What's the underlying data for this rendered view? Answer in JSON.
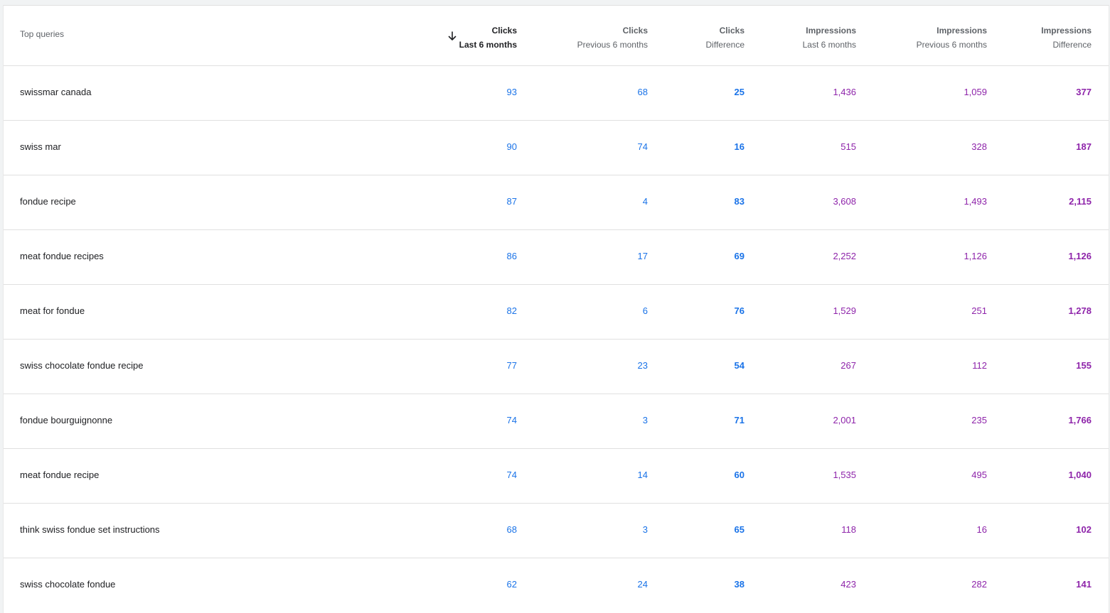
{
  "header": {
    "query_label": "Top queries",
    "columns": [
      {
        "line1": "Clicks",
        "line2": "Last 6 months",
        "sorted": true
      },
      {
        "line1": "Clicks",
        "line2": "Previous 6 months"
      },
      {
        "line1": "Clicks",
        "line2": "Difference"
      },
      {
        "line1": "Impressions",
        "line2": "Last 6 months"
      },
      {
        "line1": "Impressions",
        "line2": "Previous 6 months"
      },
      {
        "line1": "Impressions",
        "line2": "Difference"
      }
    ],
    "sort_icon": "arrow-down-icon"
  },
  "colors": {
    "clicks": "#1a73e8",
    "impressions": "#8e24aa"
  },
  "rows": [
    {
      "query": "swissmar canada",
      "clicks_last": "93",
      "clicks_prev": "68",
      "clicks_diff": "25",
      "impr_last": "1,436",
      "impr_prev": "1,059",
      "impr_diff": "377"
    },
    {
      "query": "swiss mar",
      "clicks_last": "90",
      "clicks_prev": "74",
      "clicks_diff": "16",
      "impr_last": "515",
      "impr_prev": "328",
      "impr_diff": "187"
    },
    {
      "query": "fondue recipe",
      "clicks_last": "87",
      "clicks_prev": "4",
      "clicks_diff": "83",
      "impr_last": "3,608",
      "impr_prev": "1,493",
      "impr_diff": "2,115"
    },
    {
      "query": "meat fondue recipes",
      "clicks_last": "86",
      "clicks_prev": "17",
      "clicks_diff": "69",
      "impr_last": "2,252",
      "impr_prev": "1,126",
      "impr_diff": "1,126"
    },
    {
      "query": "meat for fondue",
      "clicks_last": "82",
      "clicks_prev": "6",
      "clicks_diff": "76",
      "impr_last": "1,529",
      "impr_prev": "251",
      "impr_diff": "1,278"
    },
    {
      "query": "swiss chocolate fondue recipe",
      "clicks_last": "77",
      "clicks_prev": "23",
      "clicks_diff": "54",
      "impr_last": "267",
      "impr_prev": "112",
      "impr_diff": "155"
    },
    {
      "query": "fondue bourguignonne",
      "clicks_last": "74",
      "clicks_prev": "3",
      "clicks_diff": "71",
      "impr_last": "2,001",
      "impr_prev": "235",
      "impr_diff": "1,766"
    },
    {
      "query": "meat fondue recipe",
      "clicks_last": "74",
      "clicks_prev": "14",
      "clicks_diff": "60",
      "impr_last": "1,535",
      "impr_prev": "495",
      "impr_diff": "1,040"
    },
    {
      "query": "think swiss fondue set instructions",
      "clicks_last": "68",
      "clicks_prev": "3",
      "clicks_diff": "65",
      "impr_last": "118",
      "impr_prev": "16",
      "impr_diff": "102"
    },
    {
      "query": "swiss chocolate fondue",
      "clicks_last": "62",
      "clicks_prev": "24",
      "clicks_diff": "38",
      "impr_last": "423",
      "impr_prev": "282",
      "impr_diff": "141"
    }
  ]
}
